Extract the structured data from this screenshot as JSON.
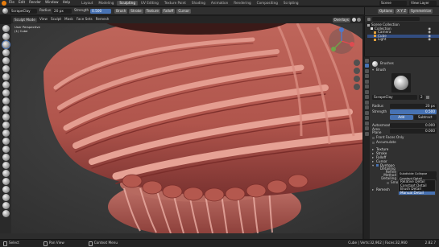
{
  "menu": {
    "file": "File",
    "edit": "Edit",
    "render": "Render",
    "window": "Window",
    "help": "Help"
  },
  "workspaces": [
    {
      "label": "Layout",
      "active": false
    },
    {
      "label": "Modeling",
      "active": false
    },
    {
      "label": "Sculpting",
      "active": true
    },
    {
      "label": "UV Editing",
      "active": false
    },
    {
      "label": "Texture Paint",
      "active": false
    },
    {
      "label": "Shading",
      "active": false
    },
    {
      "label": "Animation",
      "active": false
    },
    {
      "label": "Rendering",
      "active": false
    },
    {
      "label": "Compositing",
      "active": false
    },
    {
      "label": "Scripting",
      "active": false
    }
  ],
  "topbar_right": {
    "scene": "Scene",
    "view_layer": "View Layer"
  },
  "tool_header": {
    "brush_name": "ScrapeClay",
    "radius_label": "Radius",
    "radius_value": "20 px",
    "strength_label": "Strength",
    "strength_value": "0.500",
    "brush_menu": "Brush",
    "stroke_menu": "Stroke",
    "texture_menu": "Texture",
    "falloff_menu": "Falloff",
    "cursor_menu": "Cursor",
    "right_items": [
      "Options",
      "X Y Z",
      "Symmetrize"
    ]
  },
  "viewport_header": {
    "mode": "Sculpt Mode",
    "view": "View",
    "sculpt": "Sculpt",
    "mask": "Mask",
    "face_sets": "Face Sets",
    "remesh": "Remesh",
    "overlays": "Overlays"
  },
  "viewport_info": {
    "line1": "User Perspective",
    "line2": "(1) Cube"
  },
  "outliner": {
    "title": "Scene Collection",
    "items": [
      {
        "label": "Collection",
        "icon": "collection-icon"
      },
      {
        "label": "Camera",
        "icon": "camera-icon"
      },
      {
        "label": "Cube",
        "icon": "mesh-icon"
      },
      {
        "label": "Light",
        "icon": "light-icon"
      }
    ]
  },
  "properties": {
    "brushes_label": "Brushes",
    "brush_header": "Brush",
    "brush_name": "ScrapeClay",
    "brush_user_count": "2",
    "radius_label": "Radius",
    "radius_value": "20 px",
    "strength_label": "Strength",
    "strength_value": "0.500",
    "direction_add": "Add",
    "direction_subtract": "Subtract",
    "autosmooth_label": "Autosmooth",
    "autosmooth_value": "0.000",
    "plane_offset_label": "Area Plane",
    "plane_offset_value": "0.000",
    "front_faces": "Front Faces Only",
    "accumulate": "Accumulate",
    "sections": [
      "Texture",
      "Stroke",
      "Falloff",
      "Cursor"
    ],
    "dyntopo_label": "Dyntopo",
    "detailing_label": "Detailing",
    "refine_label": "Refine Method",
    "refine_value": "Subdivide Collapse",
    "constant_detail_label": "Constant Detail",
    "detail_size_label": "Detail Size",
    "smooth_shading": "Smooth Shading",
    "remesh_label": "Remesh",
    "version": "2.82.7"
  },
  "refine_dropdown": {
    "options": [
      {
        "label": "Relative Detail",
        "active": false
      },
      {
        "label": "Constant Detail",
        "active": false
      },
      {
        "label": "Brush Detail",
        "active": false
      },
      {
        "label": "Manual Detail",
        "active": true
      }
    ]
  },
  "status_bar": {
    "select": "Select",
    "pan_view": "Pan View",
    "context_menu": "Context Menu",
    "stats": "Cube | Verts:32,962 | Faces:32,960"
  },
  "colors": {
    "accent": "#4772b3",
    "clay": "#b8574e",
    "background": "#3d3d3d"
  }
}
